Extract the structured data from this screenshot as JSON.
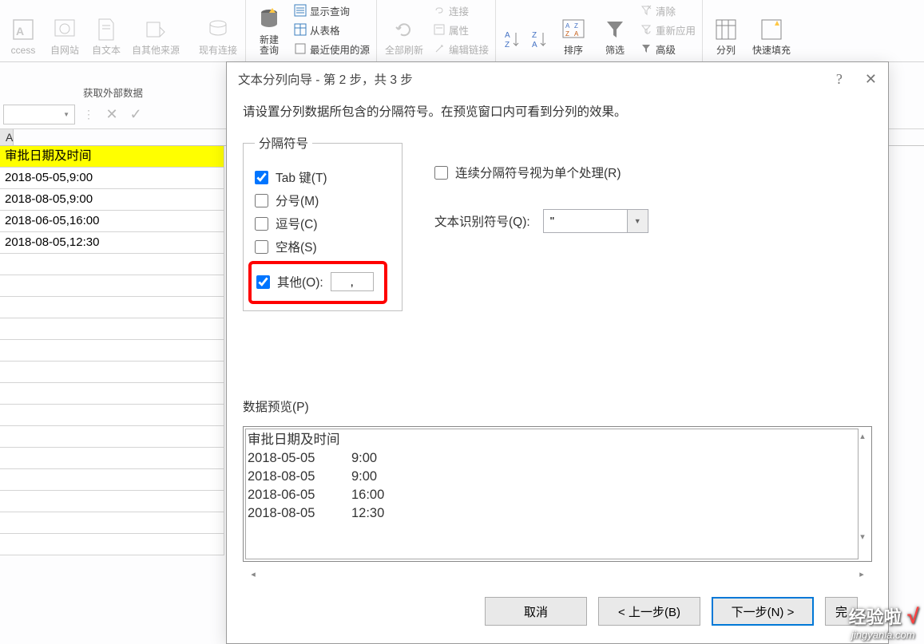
{
  "ribbon": {
    "group1": {
      "label": "获取外部数据",
      "access": "ccess",
      "web": "自网站",
      "text": "自文本",
      "other": "自其他来源",
      "existing": "现有连接"
    },
    "group2": {
      "newquery": "新建\n查询",
      "showquery": "显示查询",
      "fromtable": "从表格",
      "recent": "最近使用的源"
    },
    "group3": {
      "refresh": "全部刷新",
      "connections": "连接",
      "properties": "属性",
      "editlinks": "编辑链接"
    },
    "group4": {
      "sort": "排序",
      "filter": "筛选",
      "clear": "清除",
      "reapply": "重新应用",
      "advanced": "高级"
    },
    "group5": {
      "split": "分列",
      "flashfill": "快速填充"
    }
  },
  "sheet": {
    "colA": "A",
    "header": "审批日期及时间",
    "rows": [
      "2018-05-05,9:00",
      "2018-08-05,9:00",
      "2018-06-05,16:00",
      "2018-08-05,12:30"
    ]
  },
  "dialog": {
    "title": "文本分列向导 - 第 2 步，共 3 步",
    "instructions": "请设置分列数据所包含的分隔符号。在预览窗口内可看到分列的效果。",
    "delim_legend": "分隔符号",
    "tab_label": "Tab 键(T)",
    "semicolon_label": "分号(M)",
    "comma_label": "逗号(C)",
    "space_label": "空格(S)",
    "other_label": "其他(O):",
    "other_value": ",",
    "consecutive_label": "连续分隔符号视为单个处理(R)",
    "qualifier_label": "文本识别符号(Q):",
    "qualifier_value": "\"",
    "preview_label": "数据预览(P)",
    "preview": {
      "header": "审批日期及时间",
      "rows": [
        {
          "c1": "2018-05-05",
          "c2": "9:00"
        },
        {
          "c1": "2018-08-05",
          "c2": "9:00"
        },
        {
          "c1": "2018-06-05",
          "c2": "16:00"
        },
        {
          "c1": "2018-08-05",
          "c2": "12:30"
        }
      ]
    },
    "cancel": "取消",
    "back": "< 上一步(B)",
    "next": "下一步(N) >",
    "finish_partial": "完"
  },
  "watermark": {
    "title": "经验啦",
    "check": "√",
    "url": "jingyanla.com"
  }
}
